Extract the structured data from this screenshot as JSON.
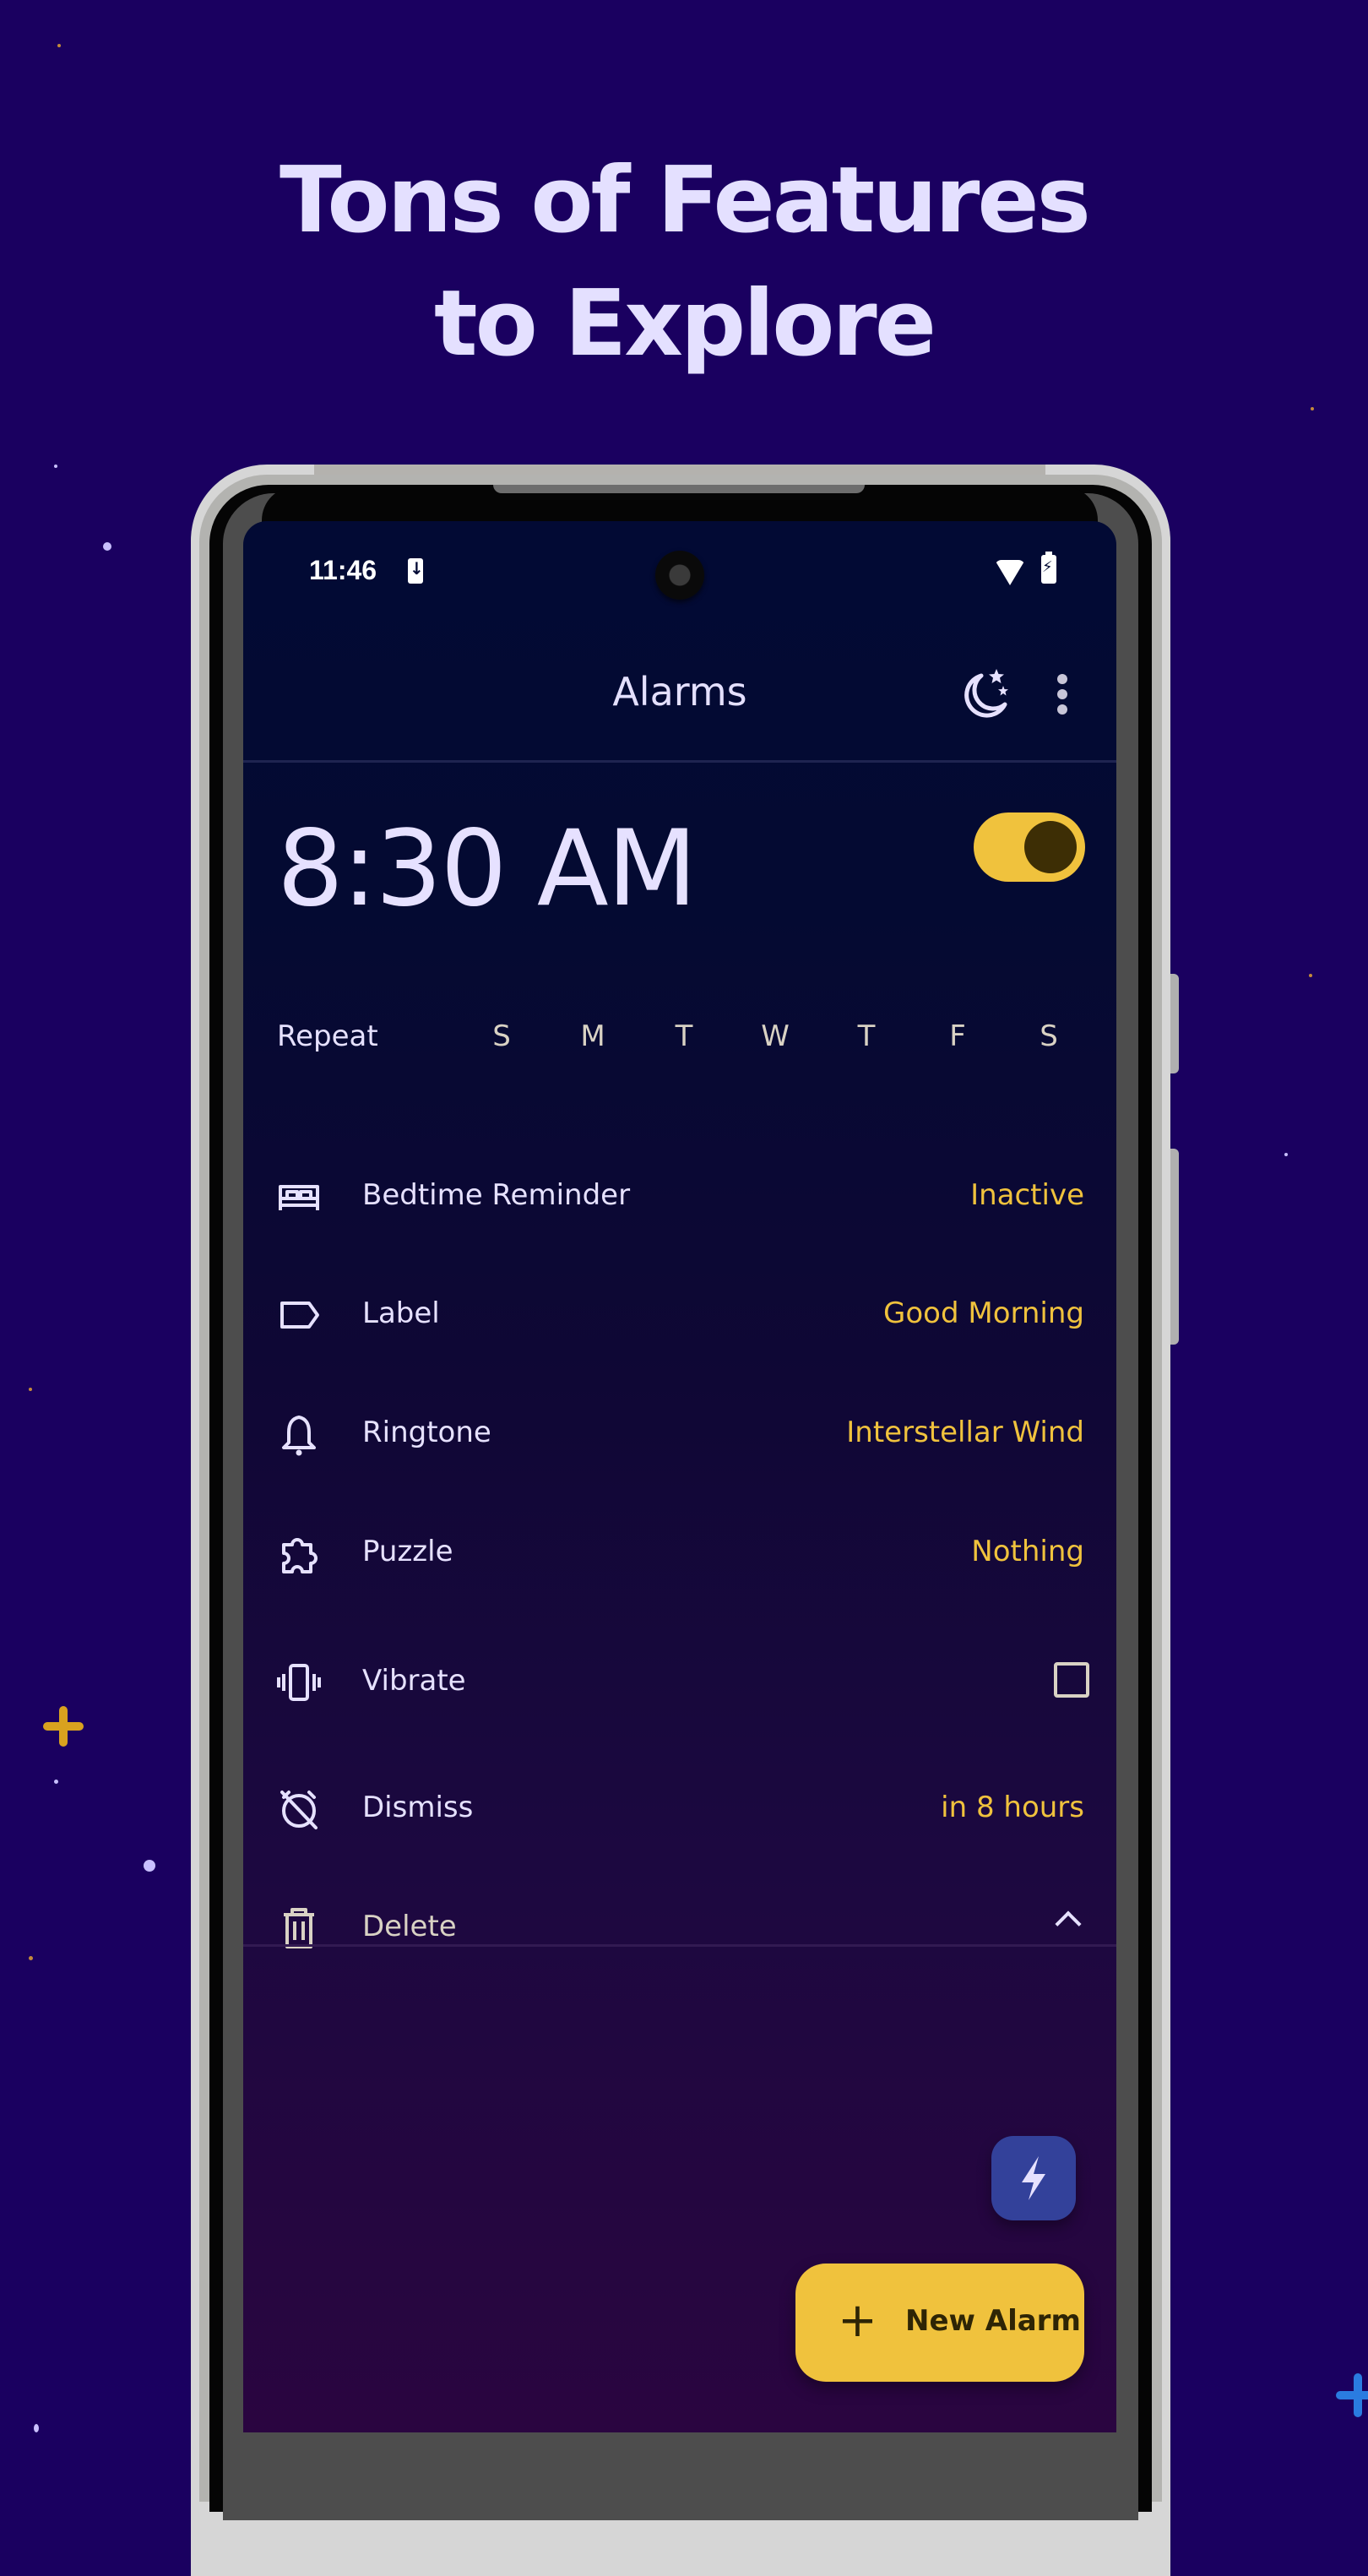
{
  "promo": {
    "headline_line1": "Tons of Features",
    "headline_line2": "to Explore"
  },
  "status_bar": {
    "time": "11:46",
    "icons": [
      "download-icon",
      "wifi-icon",
      "battery-charging-icon"
    ]
  },
  "app_bar": {
    "title": "Alarms",
    "actions": [
      {
        "name": "bedtime-moon-icon"
      },
      {
        "name": "more-options-icon"
      }
    ]
  },
  "alarm": {
    "time": "8:30 AM",
    "enabled": true,
    "repeat_label": "Repeat",
    "days": [
      "S",
      "M",
      "T",
      "W",
      "T",
      "F",
      "S"
    ],
    "settings": [
      {
        "icon": "bed-icon",
        "label": "Bedtime Reminder",
        "value": "Inactive"
      },
      {
        "icon": "label-tag-icon",
        "label": "Label",
        "value": "Good Morning"
      },
      {
        "icon": "bell-icon",
        "label": "Ringtone",
        "value": "Interstellar Wind"
      },
      {
        "icon": "puzzle-icon",
        "label": "Puzzle",
        "value": "Nothing"
      },
      {
        "icon": "vibrate-icon",
        "label": "Vibrate",
        "checked": false
      },
      {
        "icon": "alarm-off-icon",
        "label": "Dismiss",
        "value": "in 8 hours"
      },
      {
        "icon": "trash-icon",
        "label": "Delete"
      }
    ]
  },
  "fab": {
    "quick_icon": "lightning-bolt-icon",
    "new_alarm_label": "New Alarm",
    "new_alarm_icon": "+"
  },
  "colors": {
    "background": "#1a0060",
    "accent": "#f0c23d",
    "text": "#e6e1ff",
    "quick_button": "#33419a"
  }
}
